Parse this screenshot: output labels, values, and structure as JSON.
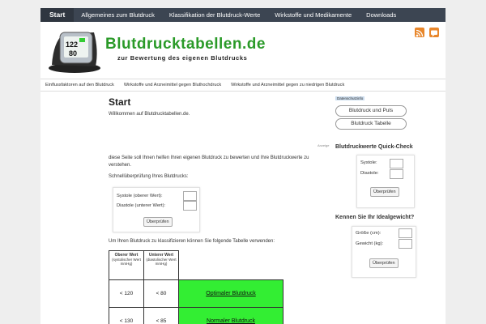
{
  "topnav": {
    "items": [
      {
        "label": "Start"
      },
      {
        "label": "Allgemeines zum Blutdruck"
      },
      {
        "label": "Klassifikation der Blutdruck-Werte"
      },
      {
        "label": "Wirkstoffe und Medikamente"
      },
      {
        "label": "Downloads"
      }
    ]
  },
  "header": {
    "title": "Blutdrucktabellen.de",
    "tagline": "zur Bewertung des eigenen Blutdrucks",
    "device_reading_sys": "122",
    "device_reading_dia": "80",
    "rss_icon": "rss-icon",
    "chat_icon": "chat-icon"
  },
  "subnav": {
    "items": [
      {
        "label": "Einflussfaktoren auf den Blutdruck"
      },
      {
        "label": "Wirkstoffe und Arzneimittel gegen Bluthochdruck"
      },
      {
        "label": "Wirkstoffe und Arzneimittel gegen zu niedrigen Blutdruck"
      }
    ]
  },
  "main": {
    "title": "Start",
    "welcome": "Willkommen auf Blutdrucktabellen.de.",
    "ad_label": "Anzeige",
    "intro": "diese Seite soll Ihnen helfen Ihren eigenen Blutdruck zu bewerten und Ihre Blutdruckwerte zu verstehen.",
    "quick_label": "Schnellüberprüfung Ihres Blutdrucks:",
    "calc": {
      "sys_label": "Systole (oberer Wert):",
      "dia_label": "Diastole (unterer Wert):",
      "button": "Überprüfen"
    },
    "table_intro": "Um Ihren Blutdruck zu klassifizieren können Sie folgende Tabelle verwenden:",
    "table": {
      "headers": [
        {
          "strong": "Oberer Wert",
          "sub": "(systolischer Wert mmHg)"
        },
        {
          "strong": "Unterer Wert",
          "sub": "(diastolischer Wert mmHg)"
        }
      ],
      "rows": [
        {
          "sys": "< 120",
          "dia": "< 80",
          "category": "Optimaler Blutdruck"
        },
        {
          "sys": "< 130",
          "dia": "< 85",
          "category": "Normaler Blutdruck"
        }
      ]
    }
  },
  "sidebar": {
    "privacy_link": "Datenschutzinfo",
    "btn_puls": "Blutdruck und Puls",
    "btn_tabelle": "Blutdruck Tabelle",
    "quick_title": "Blutdruckwerte Quick-Check",
    "quick_sys": "Systole:",
    "quick_dia": "Diastole:",
    "quick_button": "Überprüfen",
    "ideal_title": "Kennen Sie Ihr Idealgewicht?",
    "ideal_height": "Größe (cm):",
    "ideal_weight": "Gewicht (kg):",
    "ideal_button": "Überprüfen"
  }
}
